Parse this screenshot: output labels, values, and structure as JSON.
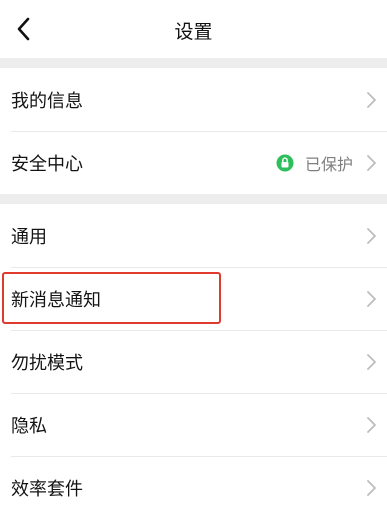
{
  "header": {
    "title": "设置"
  },
  "groups": [
    {
      "items": [
        {
          "label": "我的信息"
        },
        {
          "label": "安全中心",
          "status": "已保护"
        }
      ]
    },
    {
      "items": [
        {
          "label": "通用"
        },
        {
          "label": "新消息通知"
        },
        {
          "label": "勿扰模式"
        },
        {
          "label": "隐私"
        },
        {
          "label": "效率套件"
        }
      ]
    }
  ],
  "colors": {
    "highlight": "#e03a2f",
    "status_green": "#2cbf5b",
    "chevron": "#bdbdbd",
    "separator_band": "#ededed"
  },
  "icons": {
    "back": "chevron-left-icon",
    "row_arrow": "chevron-right-icon",
    "status": "shield-lock-icon"
  }
}
